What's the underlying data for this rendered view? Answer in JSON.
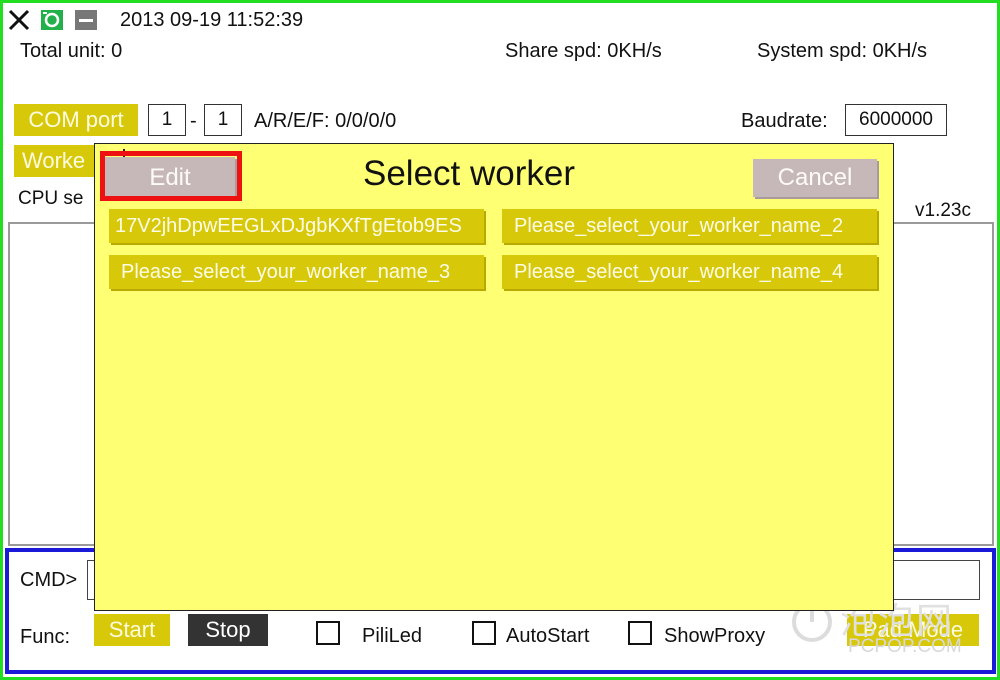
{
  "titlebar": {
    "datetime": "2013 09-19 11:52:39"
  },
  "icons": {
    "close": "x-icon",
    "camera": "camera-icon",
    "minimize": "minimize-icon"
  },
  "stats": {
    "total_unit": "Total unit: 0",
    "share_spd": "Share spd: 0KH/s",
    "system_spd": "System spd: 0KH/s"
  },
  "com": {
    "label": "COM port",
    "from": "1",
    "dash": "-",
    "to": "1",
    "aref": "A/R/E/F: 0/0/0/0"
  },
  "baud": {
    "label": "Baudrate:",
    "value": "6000000"
  },
  "worker_button": "Worke",
  "cpu_label": "CPU se",
  "version": "v1.23c",
  "cmd": {
    "label": "CMD>"
  },
  "func": {
    "label": "Func:",
    "start": "Start",
    "stop": "Stop",
    "checks": [
      "PiliLed",
      "AutoStart",
      "ShowProxy"
    ],
    "pad_mode": "Pad Mode"
  },
  "dialog": {
    "title": "Select worker",
    "edit": "Edit",
    "cancel": "Cancel",
    "workers": [
      "17V2jhDpwEEGLxDJgbKXfTgEtob9ES",
      "Please_select_your_worker_name_2",
      "Please_select_your_worker_name_3",
      "Please_select_your_worker_name_4"
    ]
  },
  "watermark": {
    "cn": "泡泡网",
    "en": "PCPOP.COM"
  },
  "colors": {
    "frame": "#22dd22",
    "button_yellow": "#d8c80a",
    "dialog_bg": "#ffff73",
    "highlight_red": "#ee1111",
    "cmd_border": "#1a1ad8",
    "stop_bg": "#333333"
  }
}
